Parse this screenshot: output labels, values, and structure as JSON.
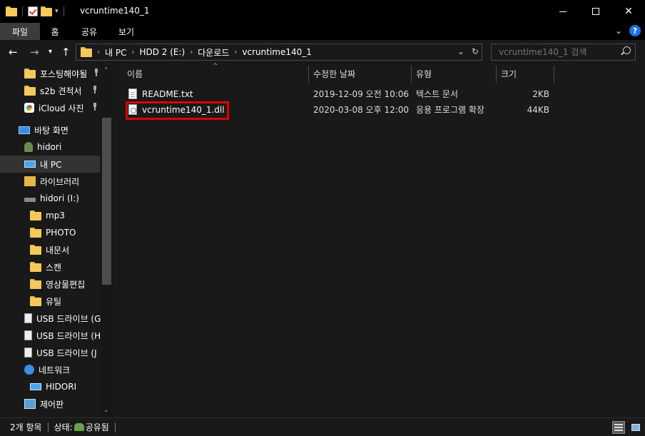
{
  "window": {
    "title": "vcruntime140_1",
    "minimize_glyph": "",
    "maximize_glyph": "",
    "close_glyph": "✕"
  },
  "ribbon": {
    "tabs": [
      {
        "label": "파일",
        "active": true
      },
      {
        "label": "홈",
        "active": false
      },
      {
        "label": "공유",
        "active": false
      },
      {
        "label": "보기",
        "active": false
      }
    ],
    "help_label": "?"
  },
  "address": {
    "breadcrumb": [
      "내 PC",
      "HDD 2 (E:)",
      "다운로드",
      "vcruntime140_1"
    ],
    "search_placeholder": "vcruntime140_1 검색"
  },
  "navigation": {
    "items": [
      {
        "label": "포스팅해야될",
        "icon": "folder-icon",
        "pinned": true
      },
      {
        "label": "s2b 견적서",
        "icon": "folder-icon",
        "pinned": true
      },
      {
        "label": "iCloud 사진",
        "icon": "icloud-icon",
        "pinned": true
      },
      {
        "label": "바탕 화면",
        "icon": "desktop-icon",
        "pinned": false
      },
      {
        "label": "hidori",
        "icon": "user-icon",
        "pinned": false
      },
      {
        "label": "내 PC",
        "icon": "pc-icon",
        "pinned": false,
        "selected": true
      },
      {
        "label": "라이브러리",
        "icon": "library-icon",
        "pinned": false
      },
      {
        "label": "hidori (I:)",
        "icon": "drive-icon",
        "pinned": false
      },
      {
        "label": "mp3",
        "icon": "folder-icon",
        "pinned": false
      },
      {
        "label": "PHOTO",
        "icon": "folder-icon",
        "pinned": false
      },
      {
        "label": "내문서",
        "icon": "folder-icon",
        "pinned": false
      },
      {
        "label": "스캔",
        "icon": "folder-icon",
        "pinned": false
      },
      {
        "label": "영상물편집",
        "icon": "folder-icon",
        "pinned": false
      },
      {
        "label": "유틸",
        "icon": "folder-icon",
        "pinned": false
      },
      {
        "label": "USB 드라이브 (G",
        "icon": "usb-icon",
        "pinned": false
      },
      {
        "label": "USB 드라이브 (H",
        "icon": "usb-icon",
        "pinned": false
      },
      {
        "label": "USB 드라이브 (J",
        "icon": "usb-icon",
        "pinned": false
      },
      {
        "label": "네트워크",
        "icon": "network-icon",
        "pinned": false
      },
      {
        "label": "HIDORI",
        "icon": "pc-icon",
        "pinned": false
      },
      {
        "label": "제어판",
        "icon": "control-panel-icon",
        "pinned": false
      }
    ]
  },
  "columns": [
    {
      "label": "이름"
    },
    {
      "label": "수정한 날짜"
    },
    {
      "label": "유형"
    },
    {
      "label": "크기"
    }
  ],
  "files": [
    {
      "name": "README.txt",
      "modified": "2019-12-09 오전 10:06",
      "type": "텍스트 문서",
      "size": "2KB",
      "icon": "text-file-icon"
    },
    {
      "name": "vcruntime140_1.dll",
      "modified": "2020-03-08 오후 12:00",
      "type": "응용 프로그램 확장",
      "size": "44KB",
      "icon": "dll-file-icon",
      "highlighted": true
    }
  ],
  "status": {
    "item_count": "2개 항목",
    "state_label": "상태:",
    "state_value": "공유됨"
  },
  "colors": {
    "background": "#191919",
    "highlight_box": "#e00000",
    "selected_nav": "#333333",
    "help_blue": "#1a73e8"
  }
}
